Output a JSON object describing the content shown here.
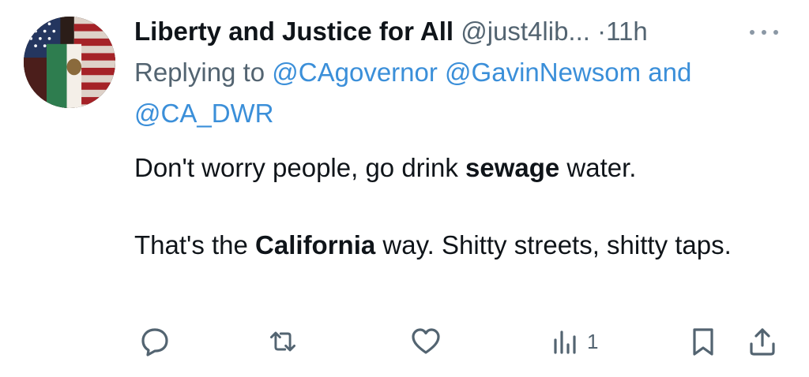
{
  "tweet": {
    "author_name": "Liberty and Justice for All",
    "handle": "@just4lib...",
    "separator": "·",
    "time": "11h",
    "replying_prefix": "Replying to",
    "mentions": [
      "@CAgovernor",
      "@GavinNewsom"
    ],
    "mentions_joiner": "and",
    "mention_last": "@CA_DWR",
    "body": {
      "line1_pre": "Don't worry people, go drink ",
      "line1_bold": "sewage",
      "line1_post": " water.",
      "line2_pre": "That's the ",
      "line2_bold": "California",
      "line2_post": " way. Shitty streets, shitty taps."
    }
  },
  "actions": {
    "reply_icon": "reply-icon",
    "retweet_icon": "retweet-icon",
    "like_icon": "heart-icon",
    "views_icon": "views-icon",
    "views_count": "1",
    "bookmark_icon": "bookmark-icon",
    "share_icon": "share-icon"
  },
  "colors": {
    "text": "#0f1419",
    "secondary": "#536471",
    "mention": "#3b8fd9"
  }
}
